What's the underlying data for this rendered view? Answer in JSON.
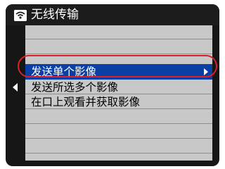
{
  "header": {
    "icon": "wifi-device-icon",
    "title": "无线传输"
  },
  "menu": {
    "items": [
      {
        "label": "发送单个影像",
        "selected": true
      },
      {
        "label": "发送所选多个影像",
        "selected": false
      },
      {
        "label": "在口上观看并获取影像",
        "selected": false
      }
    ]
  },
  "colors": {
    "screen_bg": "#161616",
    "panel_bg": "#c8c8c8",
    "selected_bg": "#0a3fa6",
    "highlight_ring": "#d8202a"
  }
}
